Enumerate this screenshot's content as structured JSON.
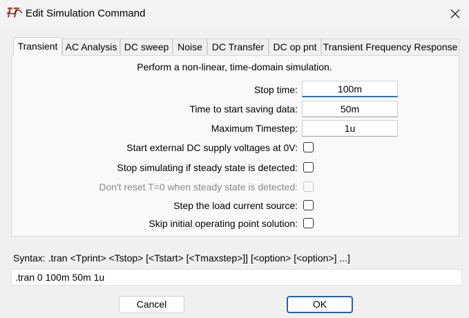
{
  "window": {
    "title": "Edit Simulation Command",
    "icon": "ltspice-logo-icon"
  },
  "tabs": [
    {
      "label": "Transient",
      "active": true
    },
    {
      "label": "AC Analysis"
    },
    {
      "label": "DC sweep"
    },
    {
      "label": "Noise"
    },
    {
      "label": "DC Transfer"
    },
    {
      "label": "DC op pnt"
    },
    {
      "label": "Transient Frequency Response"
    }
  ],
  "panel": {
    "description": "Perform a non-linear, time-domain simulation.",
    "fields": [
      {
        "label": "Stop time:",
        "value": "100m"
      },
      {
        "label": "Time to start saving data:",
        "value": "50m"
      },
      {
        "label": "Maximum Timestep:",
        "value": "1u"
      }
    ],
    "checkboxes": [
      {
        "label": "Start external DC supply voltages at 0V:",
        "checked": false,
        "enabled": true
      },
      {
        "label": "Stop simulating if steady state is detected:",
        "checked": false,
        "enabled": true
      },
      {
        "label": "Don't reset T=0 when steady state is detected:",
        "checked": false,
        "enabled": false
      },
      {
        "label": "Step the load current source:",
        "checked": false,
        "enabled": true
      },
      {
        "label": "Skip initial operating point solution:",
        "checked": false,
        "enabled": true
      }
    ]
  },
  "syntax": "Syntax:  .tran <Tprint> <Tstop> [<Tstart> [<Tmaxstep>]] [<option> [<option>] ...]",
  "command": ".tran 0 100m 50m 1u",
  "buttons": {
    "cancel": "Cancel",
    "ok": "OK"
  }
}
